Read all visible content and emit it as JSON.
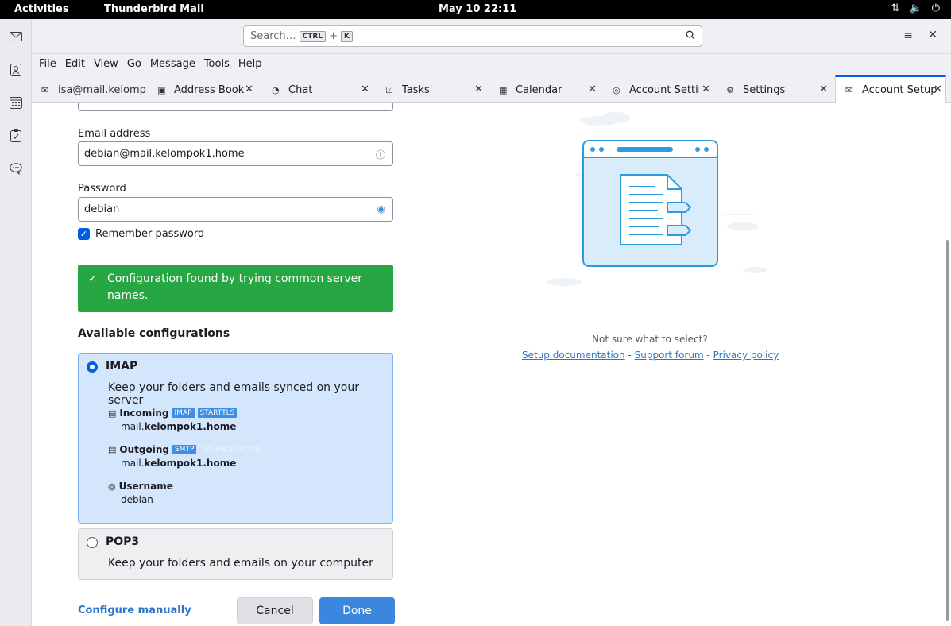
{
  "topbar": {
    "activities": "Activities",
    "app_name": "Thunderbird Mail",
    "clock": "May 10  22:11"
  },
  "toolbar": {
    "search_placeholder": "Search…",
    "shortcut_key1": "CTRL",
    "shortcut_plus": "+",
    "shortcut_key2": "K"
  },
  "menubar": [
    "File",
    "Edit",
    "View",
    "Go",
    "Message",
    "Tools",
    "Help"
  ],
  "tabs": [
    {
      "label": "isa@mail.kelomp",
      "icon": "mail-icon"
    },
    {
      "label": "Address Book",
      "icon": "address-book-icon"
    },
    {
      "label": "Chat",
      "icon": "chat-icon"
    },
    {
      "label": "Tasks",
      "icon": "tasks-icon"
    },
    {
      "label": "Calendar",
      "icon": "calendar-icon"
    },
    {
      "label": "Account Settin",
      "icon": "account-settings-icon"
    },
    {
      "label": "Settings",
      "icon": "gear-icon"
    },
    {
      "label": "Account Setup",
      "icon": "account-setup-icon",
      "active": true
    }
  ],
  "form": {
    "email_label": "Email address",
    "email_value": "debian@mail.kelompok1.home",
    "password_label": "Password",
    "password_value": "debian",
    "remember_label": "Remember password",
    "remember_checked": true
  },
  "status": {
    "message": "Configuration found by trying common server names.",
    "color": "#27a644"
  },
  "configs": {
    "title": "Available configurations",
    "imap": {
      "name": "IMAP",
      "selected": true,
      "description": "Keep your folders and emails synced on your server",
      "incoming_label": "Incoming",
      "incoming_protocol": "IMAP",
      "incoming_security": "STARTTLS",
      "incoming_host_prefix": "mail.",
      "incoming_host_domain": "kelompok1.home",
      "outgoing_label": "Outgoing",
      "outgoing_protocol": "SMTP",
      "outgoing_security": "NO ENCRYPTION",
      "outgoing_host_prefix": "mail.",
      "outgoing_host_domain": "kelompok1.home",
      "username_label": "Username",
      "username_value": "debian"
    },
    "pop3": {
      "name": "POP3",
      "selected": false,
      "description": "Keep your folders and emails on your computer"
    }
  },
  "actions": {
    "configure_manually": "Configure manually",
    "cancel": "Cancel",
    "done": "Done"
  },
  "help": {
    "question": "Not sure what to select?",
    "setup_docs": "Setup documentation",
    "sep": " - ",
    "support_forum": "Support forum",
    "privacy_policy": "Privacy policy"
  },
  "colors": {
    "accent": "#0060df",
    "selected_config_bg": "#d3e6fb",
    "done_button": "#3b87e0"
  }
}
